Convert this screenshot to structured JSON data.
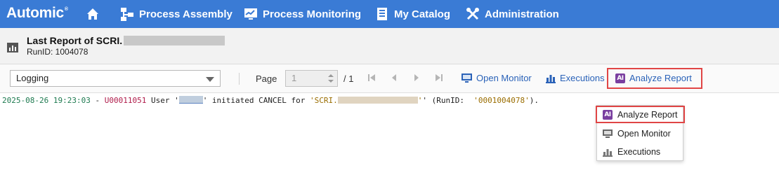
{
  "nav": {
    "logo": "Automic",
    "logo_mark": "®",
    "items": [
      {
        "label": "Process Assembly",
        "icon": "process-assembly-icon"
      },
      {
        "label": "Process Monitoring",
        "icon": "process-monitoring-icon"
      },
      {
        "label": "My Catalog",
        "icon": "catalog-icon"
      },
      {
        "label": "Administration",
        "icon": "administration-icon"
      }
    ],
    "home_icon": "home-icon",
    "color": "#3a7bd5"
  },
  "header": {
    "title": "Last Report of SCRI.",
    "runid": "RunID: 1004078",
    "icon": "report-icon"
  },
  "toolbar": {
    "report_type": "Logging",
    "page_label": "Page",
    "page_value": "1",
    "page_total": "/ 1",
    "open_monitor": "Open Monitor",
    "executions": "Executions",
    "analyze_report": "Analyze Report",
    "link_color": "#2a62b8",
    "highlight_color": "#e04545"
  },
  "log": {
    "timestamp": "2025-08-26 19:23:03",
    "sep": " - ",
    "code": "U00011051",
    "text1": " User '",
    "text2": "' initiated CANCEL for ",
    "obj_prefix": "'SCRI.",
    "text3": "' (RunID:  ",
    "runid": "'0001004078'",
    "text4": ")."
  },
  "menu": {
    "items": [
      {
        "label": "Analyze Report",
        "icon": "ai-icon"
      },
      {
        "label": "Open Monitor",
        "icon": "monitor-icon"
      },
      {
        "label": "Executions",
        "icon": "bar-chart-icon"
      }
    ]
  }
}
